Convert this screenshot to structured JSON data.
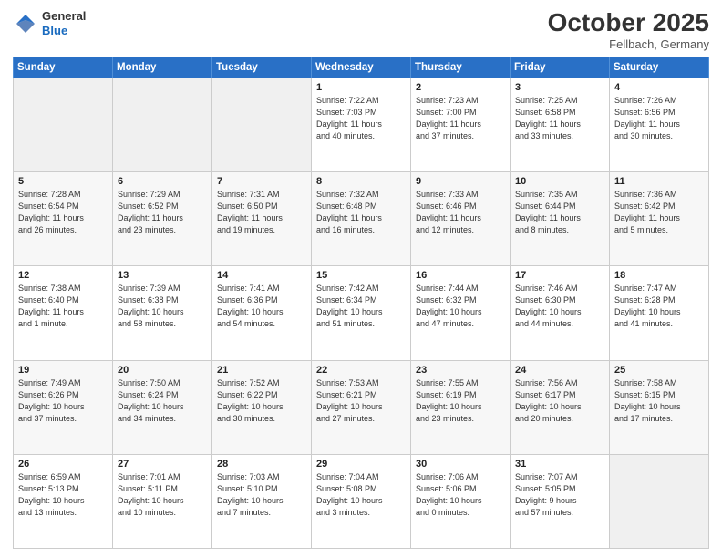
{
  "header": {
    "logo_general": "General",
    "logo_blue": "Blue",
    "month": "October 2025",
    "location": "Fellbach, Germany"
  },
  "days_of_week": [
    "Sunday",
    "Monday",
    "Tuesday",
    "Wednesday",
    "Thursday",
    "Friday",
    "Saturday"
  ],
  "weeks": [
    [
      {
        "day": "",
        "info": ""
      },
      {
        "day": "",
        "info": ""
      },
      {
        "day": "",
        "info": ""
      },
      {
        "day": "1",
        "info": "Sunrise: 7:22 AM\nSunset: 7:03 PM\nDaylight: 11 hours\nand 40 minutes."
      },
      {
        "day": "2",
        "info": "Sunrise: 7:23 AM\nSunset: 7:00 PM\nDaylight: 11 hours\nand 37 minutes."
      },
      {
        "day": "3",
        "info": "Sunrise: 7:25 AM\nSunset: 6:58 PM\nDaylight: 11 hours\nand 33 minutes."
      },
      {
        "day": "4",
        "info": "Sunrise: 7:26 AM\nSunset: 6:56 PM\nDaylight: 11 hours\nand 30 minutes."
      }
    ],
    [
      {
        "day": "5",
        "info": "Sunrise: 7:28 AM\nSunset: 6:54 PM\nDaylight: 11 hours\nand 26 minutes."
      },
      {
        "day": "6",
        "info": "Sunrise: 7:29 AM\nSunset: 6:52 PM\nDaylight: 11 hours\nand 23 minutes."
      },
      {
        "day": "7",
        "info": "Sunrise: 7:31 AM\nSunset: 6:50 PM\nDaylight: 11 hours\nand 19 minutes."
      },
      {
        "day": "8",
        "info": "Sunrise: 7:32 AM\nSunset: 6:48 PM\nDaylight: 11 hours\nand 16 minutes."
      },
      {
        "day": "9",
        "info": "Sunrise: 7:33 AM\nSunset: 6:46 PM\nDaylight: 11 hours\nand 12 minutes."
      },
      {
        "day": "10",
        "info": "Sunrise: 7:35 AM\nSunset: 6:44 PM\nDaylight: 11 hours\nand 8 minutes."
      },
      {
        "day": "11",
        "info": "Sunrise: 7:36 AM\nSunset: 6:42 PM\nDaylight: 11 hours\nand 5 minutes."
      }
    ],
    [
      {
        "day": "12",
        "info": "Sunrise: 7:38 AM\nSunset: 6:40 PM\nDaylight: 11 hours\nand 1 minute."
      },
      {
        "day": "13",
        "info": "Sunrise: 7:39 AM\nSunset: 6:38 PM\nDaylight: 10 hours\nand 58 minutes."
      },
      {
        "day": "14",
        "info": "Sunrise: 7:41 AM\nSunset: 6:36 PM\nDaylight: 10 hours\nand 54 minutes."
      },
      {
        "day": "15",
        "info": "Sunrise: 7:42 AM\nSunset: 6:34 PM\nDaylight: 10 hours\nand 51 minutes."
      },
      {
        "day": "16",
        "info": "Sunrise: 7:44 AM\nSunset: 6:32 PM\nDaylight: 10 hours\nand 47 minutes."
      },
      {
        "day": "17",
        "info": "Sunrise: 7:46 AM\nSunset: 6:30 PM\nDaylight: 10 hours\nand 44 minutes."
      },
      {
        "day": "18",
        "info": "Sunrise: 7:47 AM\nSunset: 6:28 PM\nDaylight: 10 hours\nand 41 minutes."
      }
    ],
    [
      {
        "day": "19",
        "info": "Sunrise: 7:49 AM\nSunset: 6:26 PM\nDaylight: 10 hours\nand 37 minutes."
      },
      {
        "day": "20",
        "info": "Sunrise: 7:50 AM\nSunset: 6:24 PM\nDaylight: 10 hours\nand 34 minutes."
      },
      {
        "day": "21",
        "info": "Sunrise: 7:52 AM\nSunset: 6:22 PM\nDaylight: 10 hours\nand 30 minutes."
      },
      {
        "day": "22",
        "info": "Sunrise: 7:53 AM\nSunset: 6:21 PM\nDaylight: 10 hours\nand 27 minutes."
      },
      {
        "day": "23",
        "info": "Sunrise: 7:55 AM\nSunset: 6:19 PM\nDaylight: 10 hours\nand 23 minutes."
      },
      {
        "day": "24",
        "info": "Sunrise: 7:56 AM\nSunset: 6:17 PM\nDaylight: 10 hours\nand 20 minutes."
      },
      {
        "day": "25",
        "info": "Sunrise: 7:58 AM\nSunset: 6:15 PM\nDaylight: 10 hours\nand 17 minutes."
      }
    ],
    [
      {
        "day": "26",
        "info": "Sunrise: 6:59 AM\nSunset: 5:13 PM\nDaylight: 10 hours\nand 13 minutes."
      },
      {
        "day": "27",
        "info": "Sunrise: 7:01 AM\nSunset: 5:11 PM\nDaylight: 10 hours\nand 10 minutes."
      },
      {
        "day": "28",
        "info": "Sunrise: 7:03 AM\nSunset: 5:10 PM\nDaylight: 10 hours\nand 7 minutes."
      },
      {
        "day": "29",
        "info": "Sunrise: 7:04 AM\nSunset: 5:08 PM\nDaylight: 10 hours\nand 3 minutes."
      },
      {
        "day": "30",
        "info": "Sunrise: 7:06 AM\nSunset: 5:06 PM\nDaylight: 10 hours\nand 0 minutes."
      },
      {
        "day": "31",
        "info": "Sunrise: 7:07 AM\nSunset: 5:05 PM\nDaylight: 9 hours\nand 57 minutes."
      },
      {
        "day": "",
        "info": ""
      }
    ]
  ]
}
